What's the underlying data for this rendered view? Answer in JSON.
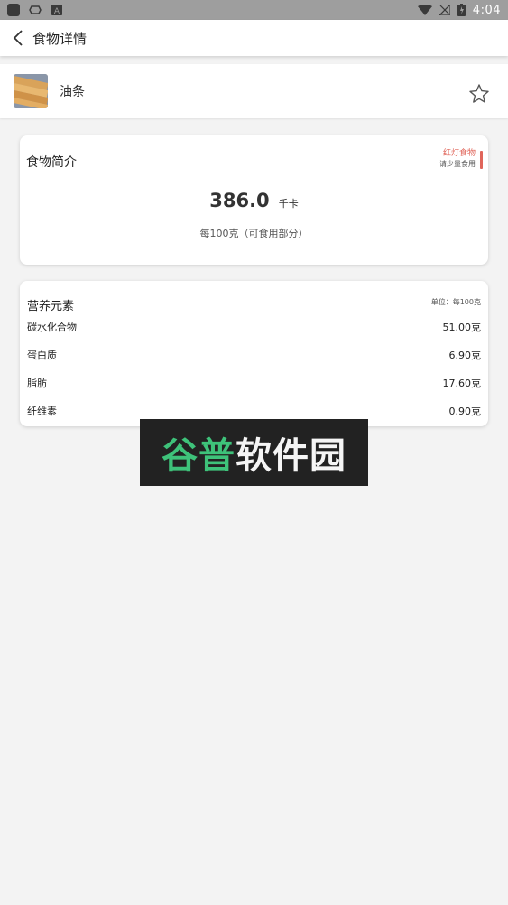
{
  "status_bar": {
    "time": "4:04"
  },
  "app_bar": {
    "title": "食物详情"
  },
  "food": {
    "name": "油条"
  },
  "intro": {
    "title": "食物简介",
    "tag_main": "红灯食物",
    "tag_sub": "请少量食用",
    "kcal_value": "386.0",
    "kcal_unit": "千卡",
    "per_text": "每100克（可食用部分）"
  },
  "nutrition": {
    "title": "营养元素",
    "unit": "单位：每100克",
    "rows": [
      {
        "name": "碳水化合物",
        "value": "51.00克"
      },
      {
        "name": "蛋白质",
        "value": "6.90克"
      },
      {
        "name": "脂肪",
        "value": "17.60克"
      },
      {
        "name": "纤维素",
        "value": "0.90克"
      }
    ]
  },
  "watermark": {
    "green": "谷普",
    "white": "软件园"
  },
  "colors": {
    "red_tag": "#e0655a",
    "watermark_green": "#3ec27a"
  }
}
